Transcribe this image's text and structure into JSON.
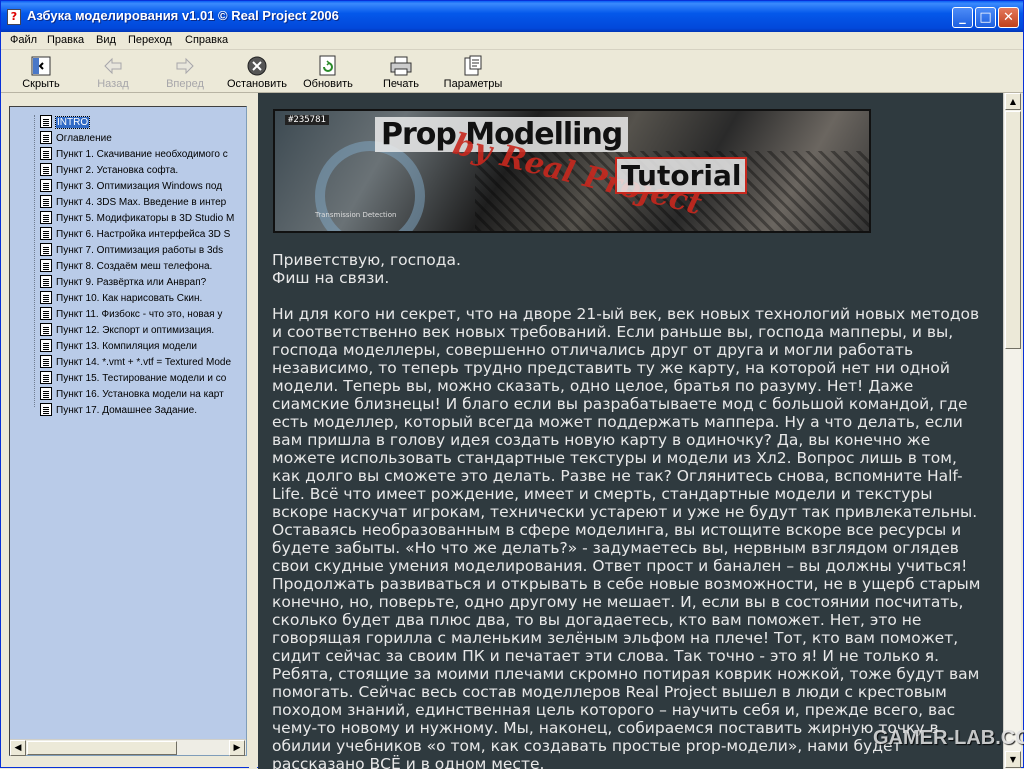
{
  "window": {
    "title": "Азбука моделирования v1.01 © Real Project 2006",
    "minimize": "_",
    "maximize": "□",
    "close": "✕"
  },
  "menu": [
    "Файл",
    "Правка",
    "Вид",
    "Переход",
    "Справка"
  ],
  "toolbar": {
    "hide": "Скрыть",
    "back": "Назад",
    "forward": "Вперед",
    "stop": "Остановить",
    "refresh": "Обновить",
    "print": "Печать",
    "options": "Параметры"
  },
  "tree": [
    "INTRO",
    "Оглавление",
    "Пункт 1. Скачивание необходимого с",
    "Пункт 2. Установка софта.",
    "Пункт 3. Оптимизация Windows под",
    "Пункт 4. 3DS Max. Введение в интер",
    "Пункт 5. Модификаторы в 3D Studio M",
    "Пункт 6. Настройка интерфейса 3D S",
    "Пункт 7. Оптимизация работы в 3ds",
    "Пункт 8. Создаём меш телефона.",
    "Пункт 9. Развёртка или Анврап?",
    "Пункт 10. Как нарисовать Скин.",
    "Пункт 11. Физбокс - что это, новая у",
    "Пункт 12. Экспорт и оптимизация.",
    "Пункт 13. Компиляция модели",
    "Пункт 14. *.vmt + *.vtf = Textured Mode",
    "Пункт 15. Тестирование модели и со",
    "Пункт 16. Установка модели на карт",
    "Пункт 17. Домашнее Задание."
  ],
  "tree_selected": 0,
  "banner": {
    "tag": "#235781",
    "line1": "Prop Modelling",
    "line2": "by Real Project",
    "line3": "Tutorial",
    "small": "Transmission Detection"
  },
  "article": [
    "Приветствую, господа.\nФиш на связи.",
    "Ни для кого ни секрет, что на дворе 21-ый век, век новых технологий новых методов и соответственно век новых требований. Если раньше вы, господа мапперы, и вы, господа моделлеры, совершенно отличались друг от друга и могли работать независимо, то теперь трудно представить ту же карту, на которой нет ни одной модели. Теперь вы, можно сказать, одно целое, братья по разуму. Нет! Даже сиамские близнецы! И благо если вы разрабатываете мод с большой командой, где есть моделлер, который всегда может поддержать маппера. Ну а что делать, если вам пришла в голову идея создать новую карту в одиночку? Да, вы конечно же можете использовать стандартные текстуры и модели из Хл2. Вопрос лишь в том, как долго вы сможете это делать. Разве не так? Оглянитесь снова, вспомните Half-Life. Всё что имеет рождение, имеет и смерть, стандартные модели и текстуры вскоре наскучат игрокам, технически устареют и уже не будут так привлекательны. Оставаясь необразованным в сфере моделинга, вы истощите вскоре все ресурсы и будете забыты. «Но что же делать?» - задумаетесь вы, нервным взглядом оглядев свои скудные умения моделирования. Ответ прост и банален – вы должны учиться! Продолжать развиваться и открывать в себе новые возможности, не в ущерб старым конечно, но, поверьте, одно другому не мешает. И, если вы в состоянии посчитать, сколько будет два плюс два, то вы догадаетесь, кто вам поможет. Нет, это не говорящая горилла с маленьким зелёным эльфом на плече! Тот, кто вам поможет, сидит сейчас за своим ПК и печатает эти слова. Так точно - это я! И не только я. Ребята, стоящие за моими плечами скромно потирая коврик ножкой, тоже будут вам помогать. Сейчас весь состав моделлеров Real Project вышел в люди с крестовым походом знаний, единственная цель которого – научить себя и, прежде всего, вас чему-то новому и нужному. Мы, наконец, собираемся поставить жирную точку в обилии учебников «о том, как создавать простые prop-модели», нами будет рассказано ВСЁ и в одном месте."
  ],
  "watermark": "GAMER-LAB.COM",
  "colors": {
    "titlebar": "#0458ea",
    "content_bg": "#2f3a3f",
    "tree_bg": "#b9cbe8",
    "selection": "#316ac5"
  }
}
